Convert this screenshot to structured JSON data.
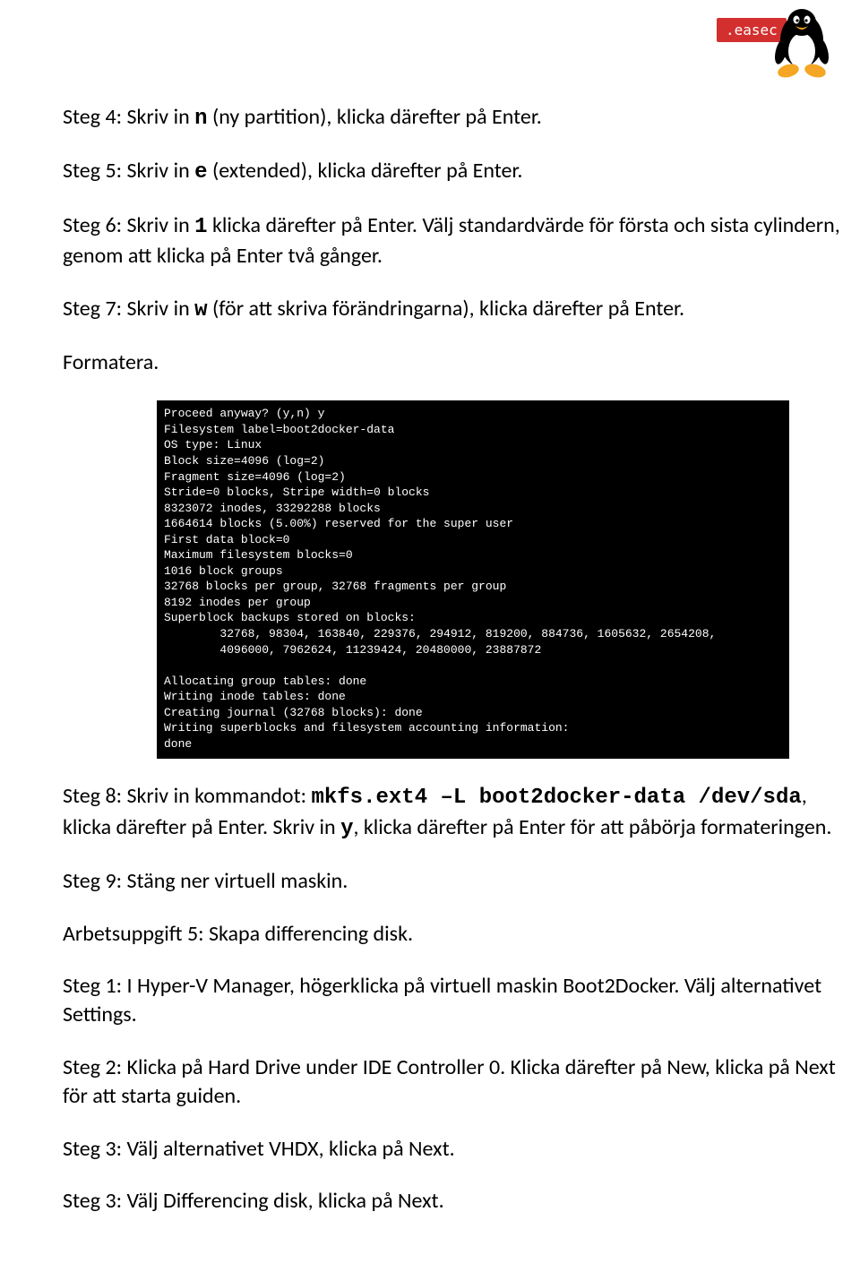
{
  "logo": {
    "badge": ".easec"
  },
  "steps": {
    "s4_a": "Steg 4: Skriv in ",
    "s4_code": "n",
    "s4_b": " (ny partition), klicka därefter på Enter.",
    "s5_a": "Steg 5: Skriv in ",
    "s5_code": "e",
    "s5_b": " (extended), klicka därefter på Enter.",
    "s6_a": "Steg 6: Skriv in ",
    "s6_code": "1",
    "s6_b": " klicka därefter på Enter. Välj standardvärde för första och sista cylindern, genom att klicka på Enter två gånger.",
    "s7_a": "Steg 7: Skriv in ",
    "s7_code": "w",
    "s7_b": " (för att skriva förändringarna), klicka därefter på Enter.",
    "formatera": "Formatera.",
    "s8_a": "Steg 8: Skriv in kommandot: ",
    "s8_code": "mkfs.ext4 –L boot2docker-data /dev/sda",
    "s8_b": ", klicka därefter på Enter. Skriv in ",
    "s8_code2": "y",
    "s8_c": ", klicka därefter på Enter för att påbörja formateringen.",
    "s9": "Steg 9: Stäng ner virtuell maskin.",
    "arb5": "Arbetsuppgift 5: Skapa differencing disk.",
    "a1": "Steg 1: I Hyper-V Manager, högerklicka på virtuell maskin Boot2Docker. Välj alternativet Settings.",
    "a2": "Steg 2: Klicka på Hard Drive under IDE Controller 0. Klicka därefter på New, klicka på Next för att starta guiden.",
    "a3a": "Steg 3: Välj alternativet VHDX, klicka på Next.",
    "a3b": "Steg 3: Välj Differencing disk, klicka på Next."
  },
  "terminal": "Proceed anyway? (y,n) y\nFilesystem label=boot2docker-data\nOS type: Linux\nBlock size=4096 (log=2)\nFragment size=4096 (log=2)\nStride=0 blocks, Stripe width=0 blocks\n8323072 inodes, 33292288 blocks\n1664614 blocks (5.00%) reserved for the super user\nFirst data block=0\nMaximum filesystem blocks=0\n1016 block groups\n32768 blocks per group, 32768 fragments per group\n8192 inodes per group\nSuperblock backups stored on blocks:\n        32768, 98304, 163840, 229376, 294912, 819200, 884736, 1605632, 2654208,\n        4096000, 7962624, 11239424, 20480000, 23887872\n\nAllocating group tables: done\nWriting inode tables: done\nCreating journal (32768 blocks): done\nWriting superblocks and filesystem accounting information:\ndone"
}
